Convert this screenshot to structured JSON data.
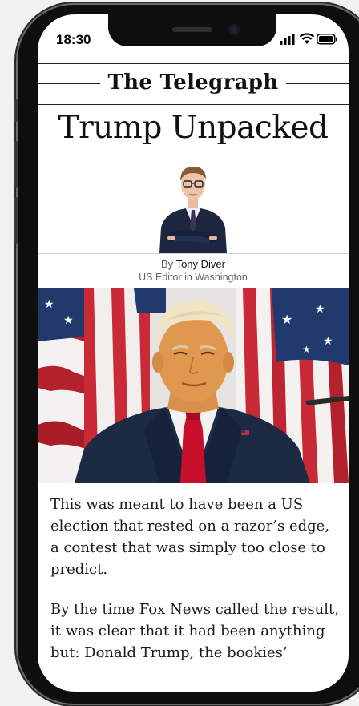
{
  "status_bar": {
    "time": "18:30"
  },
  "masthead": {
    "title": "The Telegraph"
  },
  "article": {
    "headline": "Trump Unpacked",
    "byline_prefix": "By",
    "author_name": "Tony Diver",
    "author_role": "US Editor in Washington",
    "paragraphs": [
      "This was meant to have been a US election that rested on a razor’s edge, a contest that was simply too close to predict.",
      "By the time Fox News called the result, it was clear that it had been anything but: Donald Trump, the bookies’"
    ]
  },
  "colors": {
    "frame": "#0e0e0e",
    "flag_red": "#b3222c",
    "flag_blue": "#203a6e",
    "suit": "#1c2a44",
    "tie": "#c8102e"
  },
  "icons": [
    "signal-icon",
    "wifi-icon",
    "battery-icon"
  ]
}
